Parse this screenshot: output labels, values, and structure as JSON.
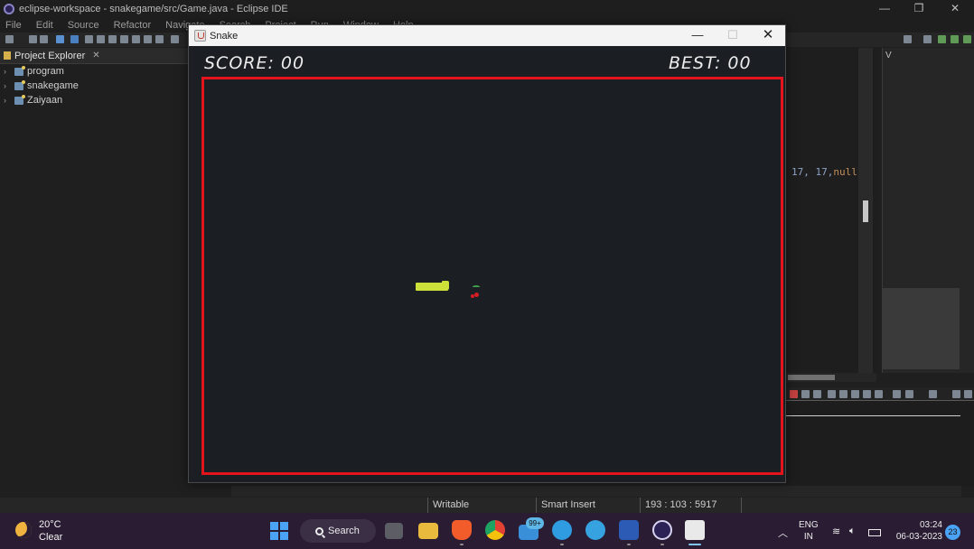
{
  "ide": {
    "title": "eclipse-workspace - snakegame/src/Game.java - Eclipse IDE",
    "menu": [
      "File",
      "Edit",
      "Source",
      "Refactor",
      "Navigate",
      "Search",
      "Project",
      "Run",
      "Window",
      "Help"
    ],
    "explorer": {
      "title": "Project Explorer",
      "projects": [
        "program",
        "snakegame",
        "Zaiyaan"
      ]
    },
    "code_fragment": "17, 17,",
    "code_fragment_null": "null",
    "right_view_tab": "V",
    "status": {
      "writable": "Writable",
      "insert_mode": "Smart Insert",
      "position": "193 : 103 : 5917"
    }
  },
  "snake_window": {
    "title": "Snake",
    "score_label": "SCORE: 00",
    "best_label": "BEST: 00",
    "score": 0,
    "best": 0,
    "colors": {
      "background": "#1b1f24",
      "border": "#e3141b",
      "snake": "#cde03a",
      "food": "#d61d24"
    }
  },
  "taskbar": {
    "weather_temp": "20°C",
    "weather_condition": "Clear",
    "search_label": "Search",
    "mail_badge": "99+",
    "language_line1": "ENG",
    "language_line2": "IN",
    "time": "03:24",
    "date": "06-03-2023",
    "notification_count": "23"
  }
}
